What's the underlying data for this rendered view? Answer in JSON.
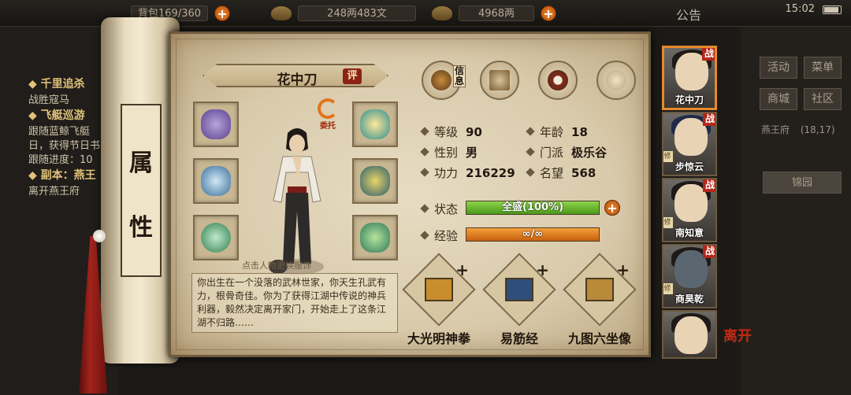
{
  "topbar": {
    "res1": "背包169/360",
    "res2": "248两483文",
    "res3": "4968两",
    "announce": "公告",
    "time": "15:02"
  },
  "bg_left": {
    "lines": [
      "◆ 千里追杀",
      "战胜寇马",
      "◆ 飞艇巡游",
      "跟随蓝鲸飞艇",
      "日，获得节日书",
      "跟随进度：10",
      "◆ 副本：燕王",
      "离开燕王府"
    ]
  },
  "scroll": {
    "title_chars": [
      "属",
      "性"
    ]
  },
  "character": {
    "name": "花中刀",
    "rate_badge": "评",
    "commission_label": "委托",
    "hint": "点击人物更换服饰",
    "bio": "你出生在一个没落的武林世家，你天生孔武有力，根骨奇佳。你为了获得江湖中传说的神兵利器，毅然决定离开家门，开始走上了这条江湖不归路……"
  },
  "tabs": [
    {
      "name": "info",
      "tag": "信息"
    },
    {
      "name": "scroll",
      "tag": ""
    },
    {
      "name": "bagua",
      "tag": ""
    },
    {
      "name": "meridian",
      "tag": ""
    }
  ],
  "stats": {
    "level_k": "等级",
    "level_v": "90",
    "age_k": "年龄",
    "age_v": "18",
    "gender_k": "性别",
    "gender_v": "男",
    "sect_k": "门派",
    "sect_v": "极乐谷",
    "power_k": "功力",
    "power_v": "216229",
    "fame_k": "名望",
    "fame_v": "568",
    "status_k": "状态",
    "status_v": "全盛(100%)",
    "status_fraction": 1.0,
    "exp_k": "经验",
    "exp_v": "∞/∞",
    "exp_fraction": 1.0
  },
  "skills": [
    {
      "name": "大光明神拳",
      "color": "#c98d2c"
    },
    {
      "name": "易筋经",
      "color": "#2f4e7a"
    },
    {
      "name": "九图六坐像",
      "color": "#b98a3a"
    }
  ],
  "roster": [
    {
      "name": "花中刀",
      "tag": "战",
      "selected": true
    },
    {
      "name": "步惊云",
      "tag": "战",
      "selected": false
    },
    {
      "name": "南知意",
      "tag": "战",
      "selected": false
    },
    {
      "name": "商昊乾",
      "tag": "战",
      "selected": false
    },
    {
      "name": "",
      "tag": "",
      "selected": false
    }
  ],
  "roster_cultivate": "修",
  "leave": "离开",
  "bg_right": {
    "btn1": "活动",
    "btn2": "菜单",
    "btn3": "商城",
    "btn4": "社区",
    "loc": "燕王府",
    "coords": "(18,17)",
    "dest": "锦园"
  },
  "colors": {
    "status_bar": "#5fb22a",
    "exp_bar": "#e5801c",
    "accent": "#e58a2a"
  }
}
